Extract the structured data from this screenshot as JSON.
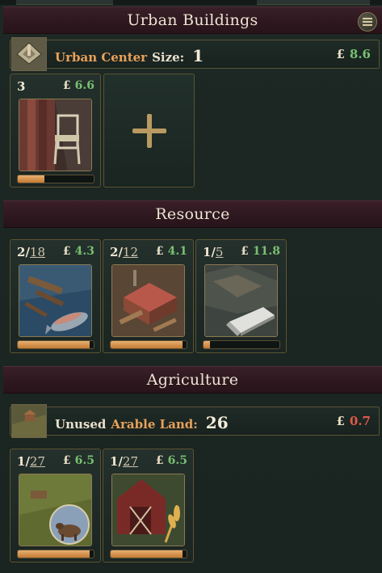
{
  "urban": {
    "title": "Urban Buildings",
    "center_label": "Urban Center",
    "size_label": "Size:",
    "size_value": "1",
    "currency": "£",
    "income": "8.6",
    "buildings": [
      {
        "count": "3",
        "income": "6.6",
        "progress": 0.35,
        "icon": "furniture-manufacturies-icon"
      }
    ],
    "add_label": "+"
  },
  "resource": {
    "title": "Resource",
    "buildings": [
      {
        "count": "2",
        "max": "18",
        "income": "4.3",
        "progress": 0.95,
        "icon": "fishing-wharf-icon"
      },
      {
        "count": "2",
        "max": "12",
        "income": "4.1",
        "progress": 0.95,
        "icon": "logging-camp-icon"
      },
      {
        "count": "1",
        "max": "5",
        "income": "11.8",
        "progress": 0.08,
        "icon": "iron-mine-icon"
      }
    ]
  },
  "agriculture": {
    "title": "Agriculture",
    "unused_label": "Unused",
    "arable_label": "Arable Land:",
    "arable_value": "26",
    "currency": "£",
    "income": "0.7",
    "buildings": [
      {
        "count": "1",
        "max": "27",
        "income": "6.5",
        "progress": 0.95,
        "icon": "livestock-ranch-icon"
      },
      {
        "count": "1",
        "max": "27",
        "income": "6.5",
        "progress": 0.95,
        "icon": "wheat-farm-icon"
      }
    ]
  },
  "colors": {
    "accent_orange": "#e8a15a",
    "positive": "#78c070",
    "negative": "#e05a4a",
    "header_bg": "#2e1820"
  }
}
